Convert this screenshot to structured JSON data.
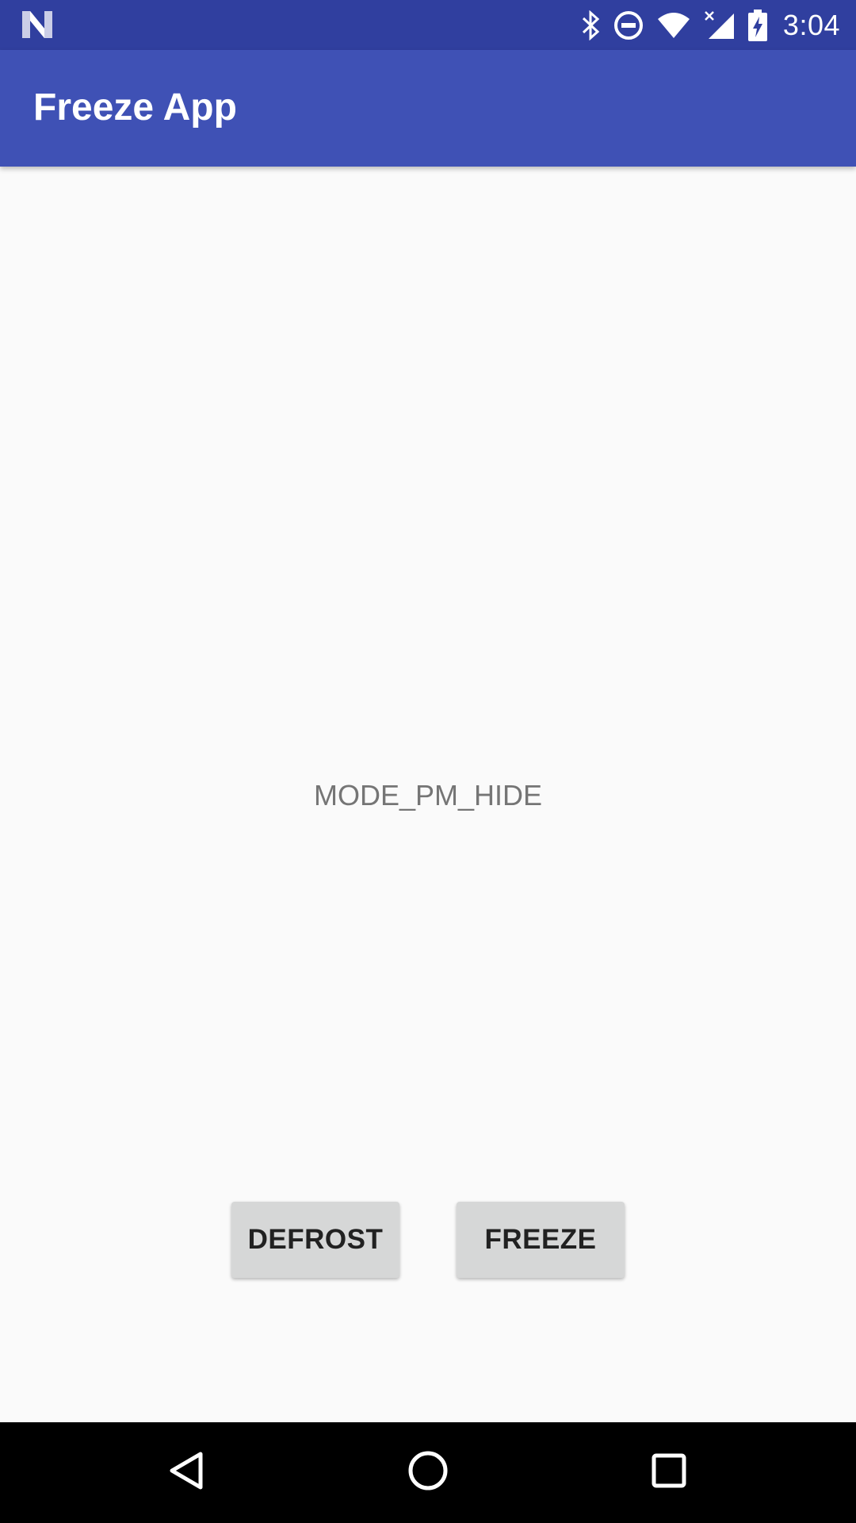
{
  "status_bar": {
    "time": "3:04",
    "icons": [
      "android-n-icon",
      "bluetooth-icon",
      "do-not-disturb-icon",
      "wifi-icon",
      "signal-icon",
      "battery-charging-icon"
    ]
  },
  "app_bar": {
    "title": "Freeze App"
  },
  "main": {
    "mode_text": "MODE_PM_HIDE",
    "buttons": {
      "defrost": "DEFROST",
      "freeze": "FREEZE"
    }
  },
  "nav_bar": {
    "icons": [
      "back-icon",
      "home-icon",
      "recents-icon"
    ]
  },
  "colors": {
    "status_bar": "#303f9f",
    "app_bar": "#3f51b5",
    "background": "#fafafa",
    "button": "#d6d7d7"
  }
}
